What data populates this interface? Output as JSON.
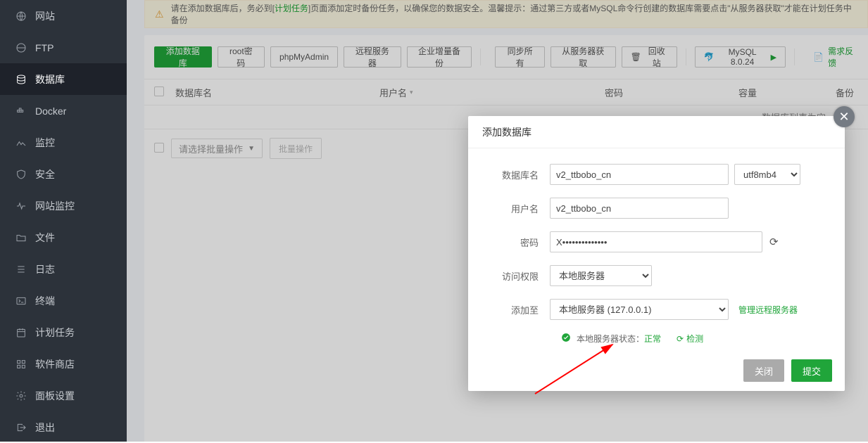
{
  "sidebar": {
    "items": [
      {
        "label": "网站"
      },
      {
        "label": "FTP"
      },
      {
        "label": "数据库"
      },
      {
        "label": "Docker"
      },
      {
        "label": "监控"
      },
      {
        "label": "安全"
      },
      {
        "label": "网站监控"
      },
      {
        "label": "文件"
      },
      {
        "label": "日志"
      },
      {
        "label": "终端"
      },
      {
        "label": "计划任务"
      },
      {
        "label": "软件商店"
      },
      {
        "label": "面板设置"
      },
      {
        "label": "退出"
      }
    ]
  },
  "alert": {
    "text1": "请在添加数据库后，务必到[",
    "link": "计划任务",
    "text2": "]页面添加定时备份任务，以确保您的数据安全。温馨提示：通过第三方或者MySQL命令行创建的数据库需要点击\"从服务器获取\"才能在计划任务中备份"
  },
  "toolbar": {
    "add_db": "添加数据库",
    "root_pwd": "root密码",
    "phpmyadmin": "phpMyAdmin",
    "remote_server": "远程服务器",
    "ent_backup": "企业增量备份",
    "sync_all": "同步所有",
    "get_from_server": "从服务器获取",
    "recycle": "回收站",
    "mysql_ver": "MySQL 8.0.24",
    "feedback": "需求反馈"
  },
  "table": {
    "col_db_name": "数据库名",
    "col_user": "用户名",
    "col_pass": "密码",
    "col_size": "容量",
    "col_backup": "备份",
    "empty": "数据库列表为空",
    "bulk_placeholder": "请选择批量操作",
    "bulk_action": "批量操作"
  },
  "modal": {
    "title": "添加数据库",
    "labels": {
      "db_name": "数据库名",
      "user": "用户名",
      "password": "密码",
      "access": "访问权限",
      "add_to": "添加至"
    },
    "values": {
      "db_name": "v2_ttbobo_cn",
      "charset": "utf8mb4",
      "user": "v2_ttbobo_cn",
      "password": "X••••••••••••••",
      "access": "本地服务器",
      "add_to": "本地服务器 (127.0.0.1)"
    },
    "remote_link": "管理远程服务器",
    "status_prefix": "本地服务器状态：",
    "status_value": "正常",
    "check": "检测",
    "footer": {
      "close": "关闭",
      "submit": "提交"
    }
  }
}
